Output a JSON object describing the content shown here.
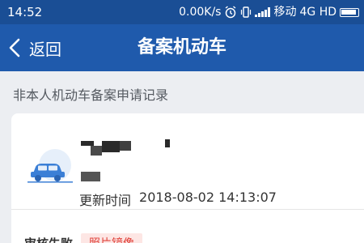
{
  "status_bar": {
    "time": "14:52",
    "network_speed": "0.00K/s",
    "carrier": "移动",
    "network_type": "4G HD",
    "icons": [
      "alarm-icon",
      "vibrate-icon",
      "signal-icon",
      "battery-icon"
    ]
  },
  "header": {
    "back_label": "返回",
    "title": "备案机动车",
    "bg_color": "#1f5aac"
  },
  "section": {
    "label": "非本人机动车备案申请记录"
  },
  "record": {
    "update_time_label": "更新时间",
    "update_time_value": "2018-08-02 14:13:07",
    "audit_status": "审核失败",
    "audit_reason": "照片镜像",
    "badge_color": "#e0443c",
    "icon": "car-icon"
  }
}
